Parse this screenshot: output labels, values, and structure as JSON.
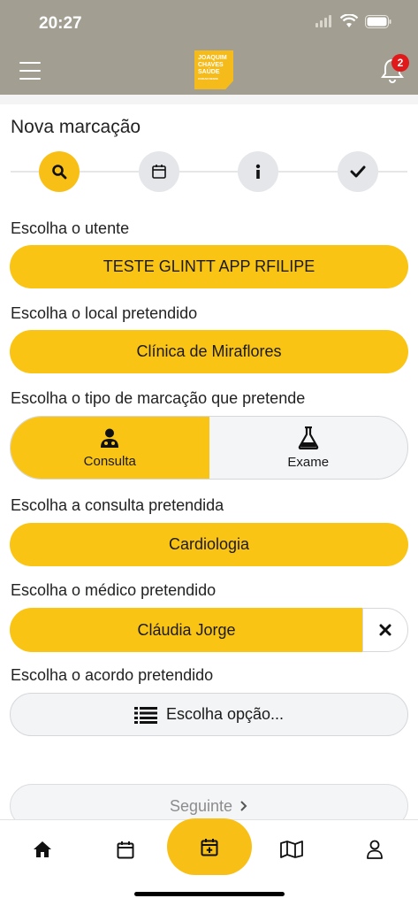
{
  "status": {
    "time": "20:27"
  },
  "header": {
    "logo_line1": "JOAQUIM",
    "logo_line2": "CHAVES",
    "logo_line3": "SAÚDE",
    "logo_tag": "CUIDAR DESDE",
    "notification_count": "2"
  },
  "page": {
    "title": "Nova marcação"
  },
  "steps": [
    "search-icon",
    "calendar-icon",
    "info-icon",
    "check-icon"
  ],
  "form": {
    "patient_label": "Escolha o utente",
    "patient_value": "TESTE GLINTT APP RFILIPE",
    "location_label": "Escolha o local pretendido",
    "location_value": "Clínica de Miraflores",
    "type_label": "Escolha o tipo de marcação que pretende",
    "type_options": [
      "Consulta",
      "Exame"
    ],
    "consult_label": "Escolha a consulta pretendida",
    "consult_value": "Cardiologia",
    "doctor_label": "Escolha o médico pretendido",
    "doctor_value": "Cláudia Jorge",
    "agreement_label": "Escolha o acordo pretendido",
    "agreement_placeholder": "Escolha opção..."
  },
  "actions": {
    "next_label": "Seguinte"
  },
  "tabbar": [
    "home-icon",
    "calendar-icon",
    "calendar-add-icon",
    "map-icon",
    "user-icon"
  ],
  "colors": {
    "accent": "#fac414",
    "header": "#a29f92",
    "badge": "#e0191a"
  }
}
